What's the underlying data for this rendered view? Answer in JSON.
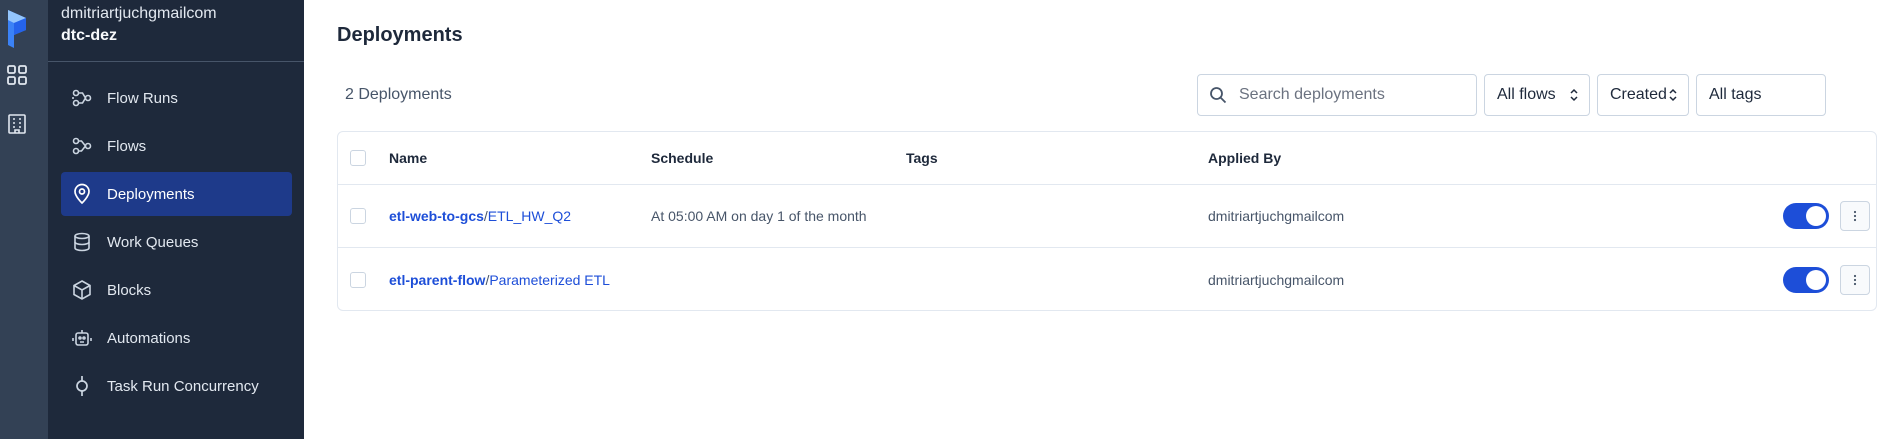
{
  "sidebar": {
    "account": "dmitriartjuchgmailcom",
    "workspace": "dtc-dez",
    "items": [
      {
        "label": "Flow Runs",
        "icon": "flow-runs-icon"
      },
      {
        "label": "Flows",
        "icon": "flows-icon"
      },
      {
        "label": "Deployments",
        "icon": "deployments-icon",
        "active": true
      },
      {
        "label": "Work Queues",
        "icon": "database-icon"
      },
      {
        "label": "Blocks",
        "icon": "cube-icon"
      },
      {
        "label": "Automations",
        "icon": "robot-icon"
      },
      {
        "label": "Task Run Concurrency",
        "icon": "concurrency-icon"
      }
    ]
  },
  "main": {
    "title": "Deployments",
    "count_label": "2 Deployments",
    "search": {
      "placeholder": "Search deployments",
      "value": ""
    },
    "filters": {
      "flows": "All flows",
      "sort": "Created",
      "tags": "All tags"
    },
    "table": {
      "headers": {
        "name": "Name",
        "schedule": "Schedule",
        "tags": "Tags",
        "applied_by": "Applied By"
      },
      "rows": [
        {
          "flow": "etl-web-to-gcs",
          "separator": "/",
          "deployment": "ETL_HW_Q2",
          "schedule": "At 05:00 AM on day 1 of the month",
          "tags": "",
          "applied_by": "dmitriartjuchgmailcom",
          "active": true
        },
        {
          "flow": "etl-parent-flow",
          "separator": "/",
          "deployment": "Parameterized ETL",
          "schedule": "",
          "tags": "",
          "applied_by": "dmitriartjuchgmailcom",
          "active": true
        }
      ]
    }
  },
  "colors": {
    "accent": "#1d4ed8",
    "sidebar_bg": "#1e293b",
    "rail_bg": "#334155",
    "active_nav": "#1e3a8a"
  }
}
